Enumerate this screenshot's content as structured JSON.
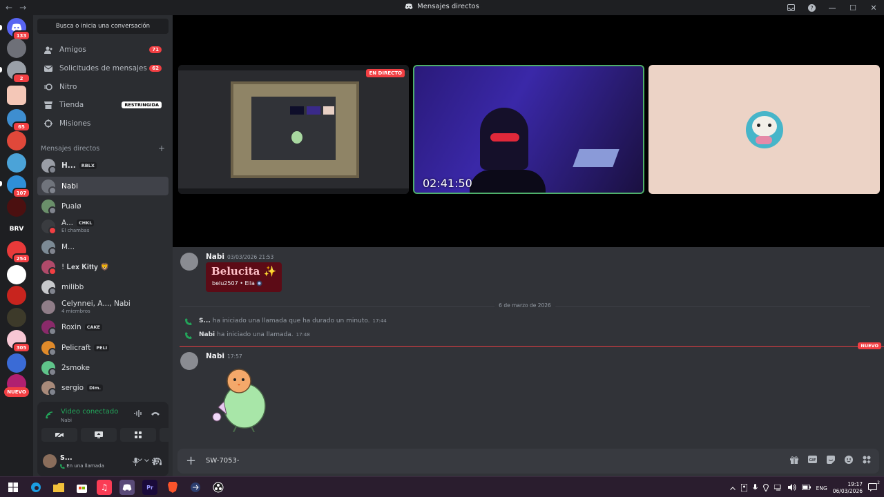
{
  "window": {
    "title": "Mensajes directos",
    "back": "←",
    "forward": "→",
    "min": "—",
    "max": "☐",
    "close": "✕"
  },
  "rail": {
    "servers": [
      {
        "badge": "133"
      },
      {
        "badge": ""
      },
      {
        "badge": "2"
      },
      {
        "badge": ""
      },
      {
        "badge": "65"
      },
      {
        "badge": ""
      },
      {
        "badge": ""
      },
      {
        "badge": "107"
      },
      {
        "badge": ""
      },
      {
        "label": "BRV",
        "badge": ""
      },
      {
        "badge": "254"
      },
      {
        "badge": ""
      },
      {
        "badge": ""
      },
      {
        "badge": ""
      },
      {
        "badge": "305"
      },
      {
        "badge": ""
      },
      {
        "badge": ""
      }
    ],
    "new_pill": "NUEVO"
  },
  "sidebar": {
    "search_label": "Busca o inicia una conversación",
    "nav": [
      {
        "label": "Amigos",
        "count": "71"
      },
      {
        "label": "Solicitudes de mensajes",
        "count": "62"
      },
      {
        "label": "Nitro"
      },
      {
        "label": "Tienda",
        "tag": "RESTRINGIDA"
      },
      {
        "label": "Misiones"
      }
    ],
    "dm_header": "Mensajes directos",
    "dm_add": "+",
    "dms": [
      {
        "name": "H...",
        "chip": "RBLX",
        "status_color": "#80848e"
      },
      {
        "name": "Nabi",
        "status_color": "#80848e"
      },
      {
        "name": "Pualø",
        "status_color": "#80848e"
      },
      {
        "name": "A...",
        "chip": "CHKL",
        "sub": "El chambas",
        "status_color": "#f23f43"
      },
      {
        "name": "M...",
        "status_color": "#80848e"
      },
      {
        "name": "! 𝐋𝐞𝐱 𝐊𝐢𝐭𝐭𝐲 🦁",
        "status_color": "#f23f43"
      },
      {
        "name": "milibb",
        "status_color": "#80848e"
      },
      {
        "name": "Celynnei, A..., Nabi",
        "sub": "4 miembros",
        "status_color": ""
      },
      {
        "name": "Roxin",
        "chip": "CAKE",
        "status_color": "#80848e"
      },
      {
        "name": "Pelicraft",
        "chip": "PELI",
        "status_color": "#80848e"
      },
      {
        "name": "2smoke",
        "status_color": "#80848e"
      },
      {
        "name": "sergio",
        "chip": "Dim.",
        "status_color": "#80848e"
      }
    ],
    "voice": {
      "status": "Video conectado",
      "channel": "Nabi"
    },
    "user": {
      "name": "S...",
      "status": "En una llamada"
    }
  },
  "call": {
    "live_label": "EN DIRECTO",
    "timer": "02:41:50"
  },
  "chat": {
    "msg1": {
      "author": "Nabi",
      "time": "03/03/2026 21:53",
      "card_title": "Belucita ✨",
      "card_sub": "belu2507 • Ella"
    },
    "date_divider": "6 de marzo de 2026",
    "sys1": {
      "author": "S...",
      "text": "ha iniciado una llamada que ha durado un minuto.",
      "time": "17:44"
    },
    "sys2": {
      "author": "Nabi",
      "text": "ha iniciado una llamada.",
      "time": "17:48"
    },
    "new_label": "NUEVO",
    "msg2": {
      "author": "Nabi",
      "time": "17:57"
    }
  },
  "composer": {
    "value": "SW-7053-"
  },
  "taskbar": {
    "apps": [
      "Pr",
      "BRV"
    ],
    "lang": "ENG",
    "time": "19:17",
    "date": "06/03/2026",
    "notif": "2"
  },
  "colors": {
    "accent": "#5865f2",
    "danger": "#f23f43",
    "online": "#23a55a"
  }
}
